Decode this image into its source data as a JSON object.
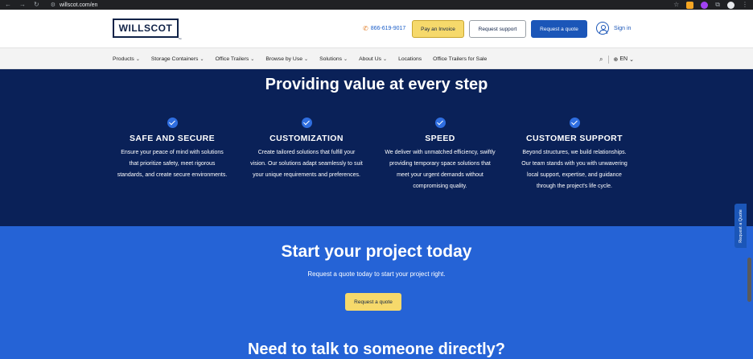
{
  "browser": {
    "url": "willscot.com/en",
    "nav_icons": [
      "back-icon",
      "forward-icon",
      "reload-icon"
    ]
  },
  "header": {
    "logo": "WILLSCOT",
    "logo_tm": "™",
    "phone": "866-619-9017",
    "pay_invoice": "Pay an Invoice",
    "request_support": "Request support",
    "request_quote": "Request a quote",
    "sign_in": "Sign in"
  },
  "nav": {
    "items": [
      {
        "label": "Products",
        "dropdown": true
      },
      {
        "label": "Storage Containers",
        "dropdown": true
      },
      {
        "label": "Office Trailers",
        "dropdown": true
      },
      {
        "label": "Browse by Use",
        "dropdown": true
      },
      {
        "label": "Solutions",
        "dropdown": true
      },
      {
        "label": "About Us",
        "dropdown": true
      },
      {
        "label": "Locations",
        "dropdown": false
      },
      {
        "label": "Office Trailers for Sale",
        "dropdown": false
      }
    ],
    "language": "EN"
  },
  "value_section": {
    "title": "Providing value at every step",
    "features": [
      {
        "title": "SAFE AND SECURE",
        "text": "Ensure your peace of mind with solutions that prioritize safety, meet rigorous standards, and create secure environments."
      },
      {
        "title": "CUSTOMIZATION",
        "text": "Create tailored solutions that fulfill your vision. Our solutions adapt seamlessly to suit your unique requirements and preferences."
      },
      {
        "title": "SPEED",
        "text": "We deliver with unmatched efficiency, swiftly providing temporary space solutions that meet your urgent demands without compromising quality."
      },
      {
        "title": "CUSTOMER SUPPORT",
        "text": "Beyond structures, we build relationships. Our team stands with you with unwavering local support, expertise, and guidance through the project's life cycle."
      }
    ]
  },
  "project_section": {
    "title": "Start your project today",
    "subtitle": "Request a quote today to start your project right.",
    "cta": "Request a quote",
    "talk_title": "Need to talk to someone directly?"
  },
  "side_tab": "Request a Quote",
  "colors": {
    "navy": "#0a2158",
    "blue": "#2563d6",
    "yellow": "#f6d96b",
    "button_blue": "#1b56b8"
  }
}
